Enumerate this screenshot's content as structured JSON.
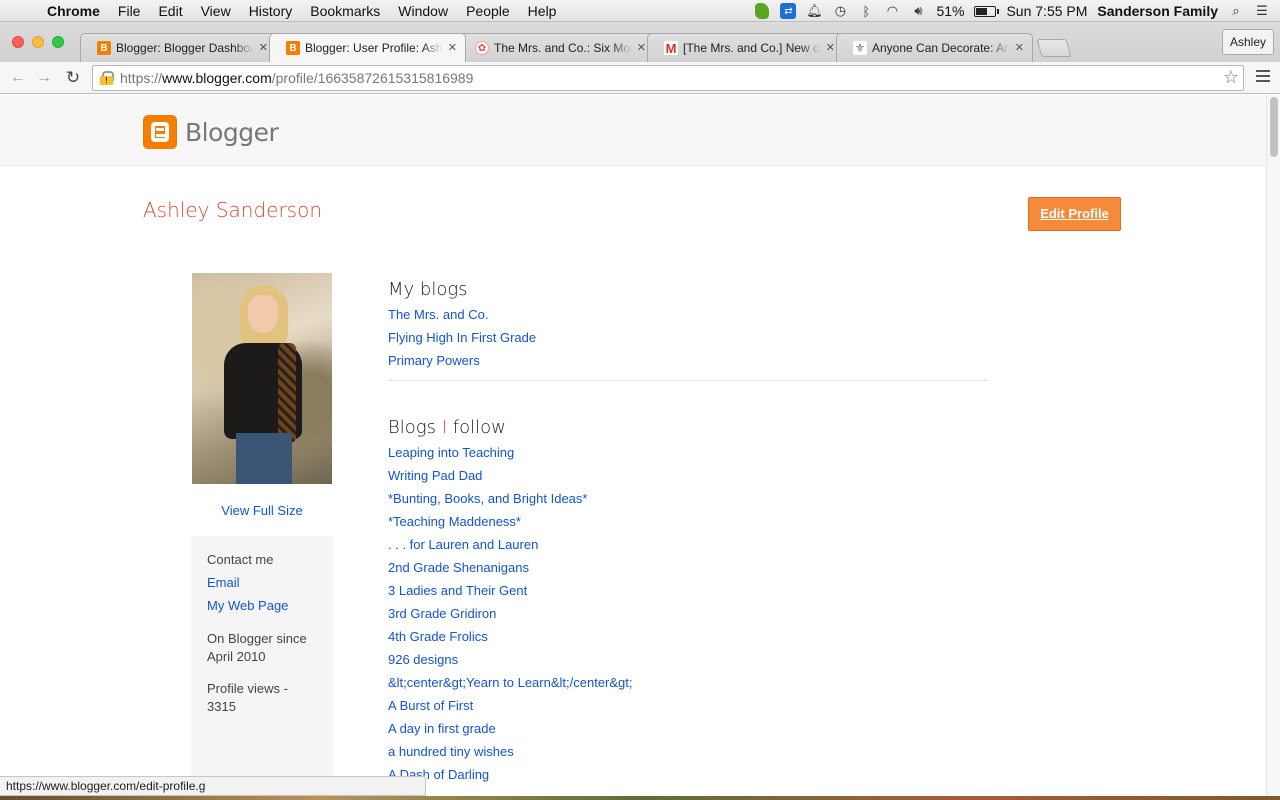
{
  "menubar": {
    "app": "Chrome",
    "items": [
      "File",
      "Edit",
      "View",
      "History",
      "Bookmarks",
      "Window",
      "People",
      "Help"
    ],
    "battery_percent": "51%",
    "battery_level": 0.51,
    "clock": "Sun 7:55 PM",
    "user": "Sanderson Family"
  },
  "browser": {
    "tabs": [
      {
        "title": "Blogger: Blogger Dashboard",
        "icon": "blogger-icon",
        "active": false
      },
      {
        "title": "Blogger: User Profile: Ashley Sanderson",
        "icon": "blogger-icon",
        "active": true
      },
      {
        "title": "The Mrs. and Co.: Six Months",
        "icon": "flower-icon",
        "active": false
      },
      {
        "title": "[The Mrs. and Co.] New comment",
        "icon": "gmail-icon",
        "active": false
      },
      {
        "title": "Anyone Can Decorate: Are",
        "icon": "fleur-de-lis-icon",
        "active": false
      }
    ],
    "profile_button": "Ashley",
    "url": {
      "scheme": "https://",
      "host": "www.blogger.com",
      "path": "/profile/16635872615315816989"
    },
    "status_url": "https://www.blogger.com/edit-profile.g"
  },
  "page": {
    "logo_text": "Blogger",
    "profile_name": "Ashley Sanderson",
    "edit_profile_label": "Edit Profile",
    "view_full_size": "View Full Size",
    "sidebar": {
      "contact_heading": "Contact me",
      "email_label": "Email",
      "webpage_label": "My Web Page",
      "since_line1": "On Blogger since",
      "since_line2": "April 2010",
      "profile_views": "Profile views - 3315"
    },
    "my_blogs": {
      "heading": "My blogs",
      "items": [
        "The Mrs. and Co.",
        "Flying High In First Grade",
        "Primary Powers"
      ]
    },
    "blogs_follow": {
      "heading_pre": "Blogs ",
      "heading_accent": "I",
      "heading_post": " follow",
      "items": [
        "Leaping into Teaching",
        "Writing Pad Dad",
        "*Bunting, Books, and Bright Ideas*",
        "*Teaching Maddeness*",
        ". . . for Lauren and Lauren",
        "2nd Grade Shenanigans",
        "3 Ladies and Their Gent",
        "3rd Grade Gridiron",
        "4th Grade Frolics",
        "926 designs",
        "&lt;center&gt;Yearn to Learn&lt;/center&gt;",
        "A Burst of First",
        "A day in first grade",
        "a hundred tiny wishes",
        "A Dash of Darling"
      ]
    }
  },
  "colors": {
    "blogger_orange": "#f57d00",
    "name_red": "#dd4b2f",
    "link_blue": "#1155cc",
    "edit_button": "#f58a3a"
  }
}
